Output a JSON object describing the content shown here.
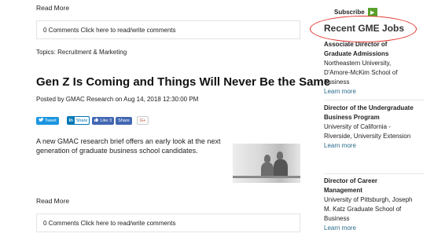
{
  "post_top": {
    "read_more": "Read More",
    "comments": "0 Comments Click here to read/write comments",
    "topics": "Topics: Recruitment & Marketing"
  },
  "post": {
    "title": "Gen Z Is Coming and Things Will Never Be the Same",
    "meta": "Posted by GMAC Research on Aug 14, 2018 12:30:00 PM",
    "share": {
      "tweet": "Tweet",
      "linkedin": "Share",
      "facebook_like": "Like 3",
      "facebook_share": "Share",
      "google_plus": "G+"
    },
    "body": "A new GMAC research brief offers an early look at the next generation of graduate business school candidates.",
    "read_more": "Read More",
    "comments": "0 Comments Click here to read/write comments"
  },
  "sidebar": {
    "subscribe": "Subscribe",
    "jobs_title": "Recent GME Jobs",
    "jobs": [
      {
        "title": "Associate Director of Graduate Admissions",
        "org": "Northeastern University, D'Amore-McKim School of Business",
        "learn_more": "Learn more"
      },
      {
        "title": "Director of the Undergraduate Business Program",
        "org": "University of California - Riverside, University Extension",
        "learn_more": "Learn more"
      },
      {
        "title": "Director of Career Management",
        "org": "University of Pittsburgh, Joseph M. Katz Graduate School of Business",
        "learn_more": "Learn more"
      }
    ]
  },
  "colors": {
    "annotation_ellipse": "#e0352b",
    "subscribe_arrow": "#5aa02c",
    "learn_more_link": "#2a6a8c",
    "tweet_button": "#1b95e0",
    "linkedin": "#0077b5",
    "facebook": "#4267b2"
  },
  "icons": [
    "twitter-bird-icon",
    "linkedin-icon",
    "facebook-thumb-icon",
    "google-plus-icon",
    "arrow-right-icon"
  ]
}
